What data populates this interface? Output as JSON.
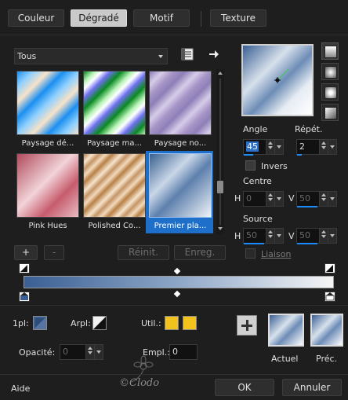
{
  "tabs": [
    {
      "label": "Couleur",
      "active": false
    },
    {
      "label": "Dégradé",
      "active": true
    },
    {
      "label": "Motif",
      "active": false
    },
    {
      "label": "Texture",
      "active": false
    }
  ],
  "preset_dropdown": {
    "value": "Tous"
  },
  "presets": [
    {
      "name": "Paysage dé..."
    },
    {
      "name": "Paysage ma..."
    },
    {
      "name": "Paysage no..."
    },
    {
      "name": "Pink Hues"
    },
    {
      "name": "Polished Co..."
    },
    {
      "name": "Premier pla...",
      "selected": true
    }
  ],
  "buttons": {
    "add": "+",
    "remove": "-",
    "reset": "Réinit.",
    "save": "Enreg.",
    "ok": "OK",
    "cancel": "Annuler",
    "help": "Aide"
  },
  "angle": {
    "label": "Angle",
    "value": "45"
  },
  "repeat": {
    "label": "Répét.",
    "value": "2"
  },
  "invert": {
    "label": "Invers"
  },
  "center": {
    "label": "Centre",
    "h_label": "H",
    "h": "0",
    "v_label": "V",
    "v": "50"
  },
  "source": {
    "label": "Source",
    "h_label": "H",
    "h": "50",
    "v_label": "V",
    "v": "50"
  },
  "link": {
    "label": "Liaison"
  },
  "bottom": {
    "pl_label": "1pl:",
    "arpl_label": "Arpl:",
    "util_label": "Util.:",
    "opacity_label": "Opacité:",
    "opacity_value": "0",
    "empl_label": "Empl.:",
    "empl_value": "0"
  },
  "previews": {
    "current": "Actuel",
    "previous": "Préc."
  },
  "watermark": "©Clodo",
  "colors": {
    "accent": "#1e6fc9",
    "swatch_gold": "#f2c31c",
    "grad_dark": "#3a5f93",
    "grad_light": "#f2f2f2"
  }
}
